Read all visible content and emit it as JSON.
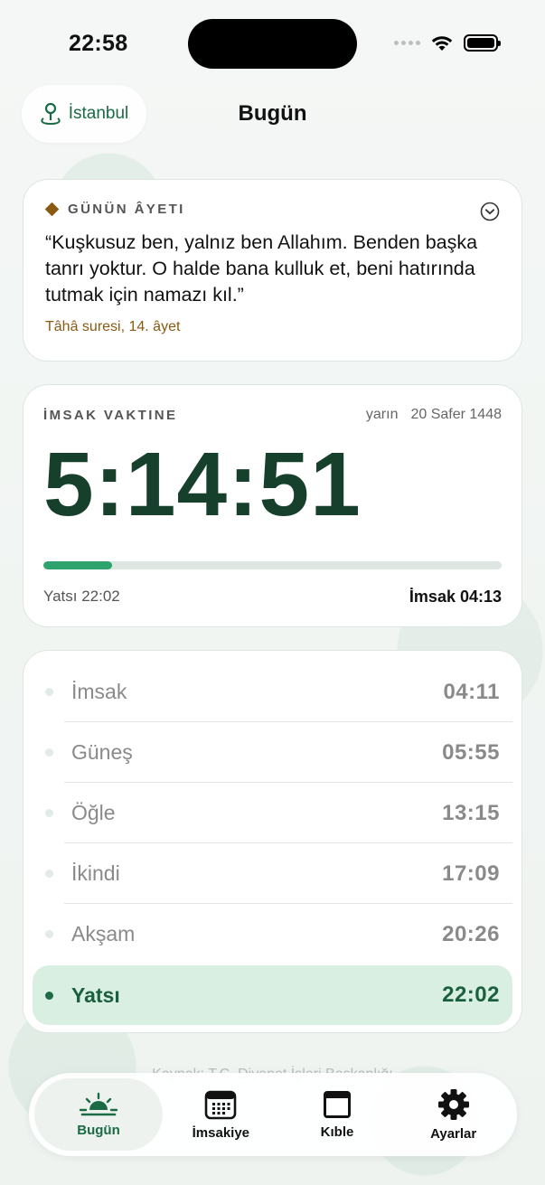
{
  "status_bar": {
    "time": "22:58"
  },
  "header": {
    "city": "İstanbul",
    "title": "Bugün"
  },
  "verse": {
    "title": "GÜNÜN ÂYETI",
    "text": "“Kuşkusuz ben, yalnız ben Allahım. Benden başka tanrı yoktur. O halde bana kulluk et, beni hatırında tutmak için namazı kıl.”",
    "reference": "Tâhâ suresi, 14. âyet"
  },
  "countdown": {
    "label": "İMSAK VAKTINE",
    "day": "yarın",
    "hijri_date": "20 Safer 1448",
    "remaining": "5:14:51",
    "progress_fraction": 0.15,
    "previous": "Yatsı 22:02",
    "next": "İmsak 04:13"
  },
  "prayer_times": [
    {
      "name": "İmsak",
      "time": "04:11",
      "active": false
    },
    {
      "name": "Güneş",
      "time": "05:55",
      "active": false
    },
    {
      "name": "Öğle",
      "time": "13:15",
      "active": false
    },
    {
      "name": "İkindi",
      "time": "17:09",
      "active": false
    },
    {
      "name": "Akşam",
      "time": "20:26",
      "active": false
    },
    {
      "name": "Yatsı",
      "time": "22:02",
      "active": true
    }
  ],
  "footer_note": "Kaynak: T.C. Diyanet İşleri Başkanlığı",
  "tabs": [
    {
      "label": "Bugün",
      "icon": "sunrise-icon",
      "active": true
    },
    {
      "label": "İmsakiye",
      "icon": "calendar-icon",
      "active": false
    },
    {
      "label": "Kıble",
      "icon": "window-icon",
      "active": false
    },
    {
      "label": "Ayarlar",
      "icon": "gear-icon",
      "active": false
    }
  ],
  "colors": {
    "accent": "#1a6b45",
    "countdown": "#163f2c",
    "progress": "#2fa36d",
    "gold": "#8a5a12",
    "active_row": "#d9efe2"
  }
}
